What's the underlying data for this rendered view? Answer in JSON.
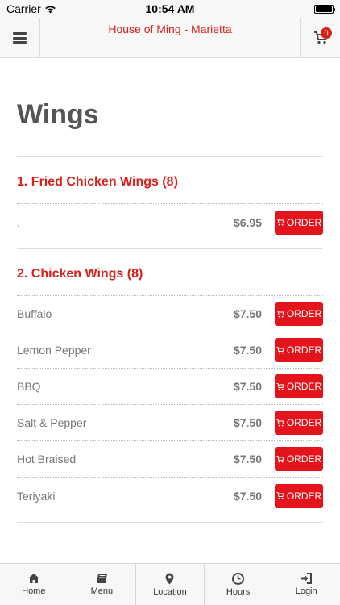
{
  "status_bar": {
    "carrier": "Carrier",
    "time": "10:54 AM"
  },
  "header": {
    "title": "House of Ming - Marietta",
    "cart_count": "0"
  },
  "page_title": "Wings",
  "order_label": "ORDER",
  "categories": [
    {
      "title": "1. Fried Chicken Wings (8)",
      "items": [
        {
          "name": ".",
          "price": "$6.95"
        }
      ]
    },
    {
      "title": "2. Chicken Wings (8)",
      "items": [
        {
          "name": "Buffalo",
          "price": "$7.50"
        },
        {
          "name": "Lemon Pepper",
          "price": "$7.50"
        },
        {
          "name": "BBQ",
          "price": "$7.50"
        },
        {
          "name": "Salt & Pepper",
          "price": "$7.50"
        },
        {
          "name": "Hot Braised",
          "price": "$7.50"
        },
        {
          "name": "Teriyaki",
          "price": "$7.50"
        }
      ]
    }
  ],
  "tabs": [
    {
      "label": "Home",
      "icon": "home-icon"
    },
    {
      "label": "Menu",
      "icon": "book-icon"
    },
    {
      "label": "Location",
      "icon": "map-marker-icon"
    },
    {
      "label": "Hours",
      "icon": "clock-icon"
    },
    {
      "label": "Login",
      "icon": "sign-in-icon"
    }
  ],
  "colors": {
    "accent": "#d9201a",
    "order_button": "#e3141b",
    "text_muted": "#777777",
    "bar_bg": "#f7f7f7"
  }
}
